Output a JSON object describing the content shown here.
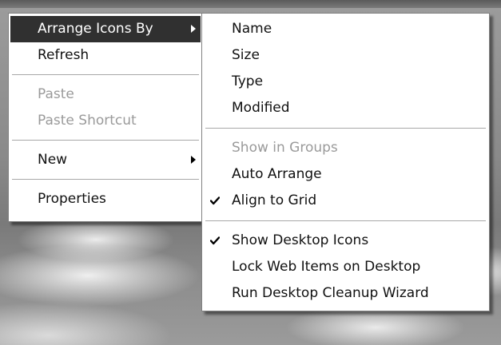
{
  "context_menu": {
    "items": [
      {
        "label": "Arrange Icons By",
        "state": "highlighted",
        "submenu": true
      },
      {
        "label": "Refresh",
        "state": "enabled"
      },
      {
        "label": "Paste",
        "state": "disabled"
      },
      {
        "label": "Paste Shortcut",
        "state": "disabled"
      },
      {
        "label": "New",
        "state": "enabled",
        "submenu": true
      },
      {
        "label": "Properties",
        "state": "enabled"
      }
    ]
  },
  "arrange_submenu": {
    "items": [
      {
        "label": "Name",
        "state": "enabled"
      },
      {
        "label": "Size",
        "state": "enabled"
      },
      {
        "label": "Type",
        "state": "enabled"
      },
      {
        "label": "Modified",
        "state": "enabled"
      },
      {
        "label": "Show in Groups",
        "state": "disabled"
      },
      {
        "label": "Auto Arrange",
        "state": "enabled"
      },
      {
        "label": "Align to Grid",
        "state": "enabled",
        "checked": true
      },
      {
        "label": "Show Desktop Icons",
        "state": "enabled",
        "checked": true
      },
      {
        "label": "Lock Web Items on Desktop",
        "state": "enabled"
      },
      {
        "label": "Run Desktop Cleanup Wizard",
        "state": "enabled"
      }
    ]
  },
  "colors": {
    "highlight_bg": "#303030",
    "highlight_text": "#ffffff",
    "disabled_text": "#9a9a9a",
    "menu_bg": "#ffffff"
  },
  "icons": {
    "submenu_arrow": "chevron-right-icon",
    "checked": "checkmark-icon"
  }
}
